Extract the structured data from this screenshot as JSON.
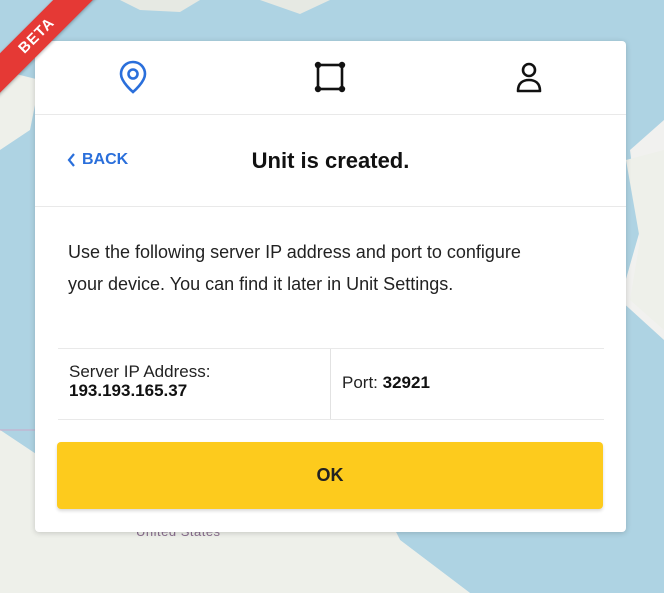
{
  "ribbon": {
    "label": "BETA"
  },
  "map": {
    "region_label": "United States"
  },
  "nav": {
    "items": [
      {
        "icon": "location-pin-icon"
      },
      {
        "icon": "area-polygon-icon"
      },
      {
        "icon": "user-icon"
      }
    ]
  },
  "header": {
    "back_label": "BACK",
    "title": "Unit is created."
  },
  "body": {
    "description": "Use the following server IP address and port to configure your device. You can find it later in Unit Settings."
  },
  "server": {
    "ip_label": "Server IP Address:",
    "ip_value": "193.193.165.37",
    "port_label": "Port: ",
    "port_value": "32921"
  },
  "actions": {
    "ok_label": "OK"
  },
  "colors": {
    "accent_blue": "#2a6fdb",
    "ok_yellow": "#fdcb1d",
    "beta_red": "#e53935"
  }
}
